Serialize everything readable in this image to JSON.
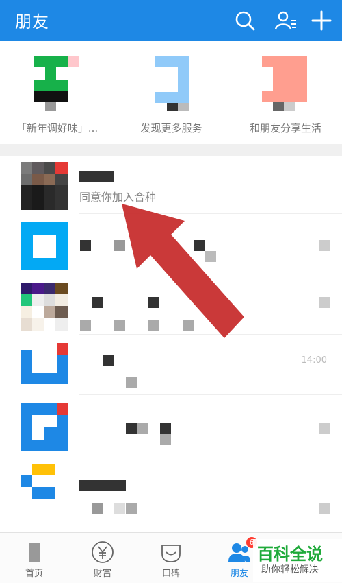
{
  "header": {
    "title": "朋友",
    "bg": "#1e88e5"
  },
  "services": [
    {
      "label": "「新年调好味」...",
      "icon": "green-app-icon"
    },
    {
      "label": "发现更多服务",
      "icon": "blue-app-icon"
    },
    {
      "label": "和朋友分享生活",
      "icon": "pink-app-icon"
    }
  ],
  "friend_request": {
    "subtitle": "同意你加入合种"
  },
  "list_time": "14:00",
  "tabs": [
    {
      "label": "首页",
      "icon": "home-icon"
    },
    {
      "label": "财富",
      "icon": "yen-icon"
    },
    {
      "label": "口碑",
      "icon": "koubei-icon"
    },
    {
      "label": "朋友",
      "icon": "friends-icon",
      "active": true,
      "badge": "6"
    }
  ],
  "watermark": {
    "line1": "百科全说",
    "line2": "助你轻松解决"
  }
}
